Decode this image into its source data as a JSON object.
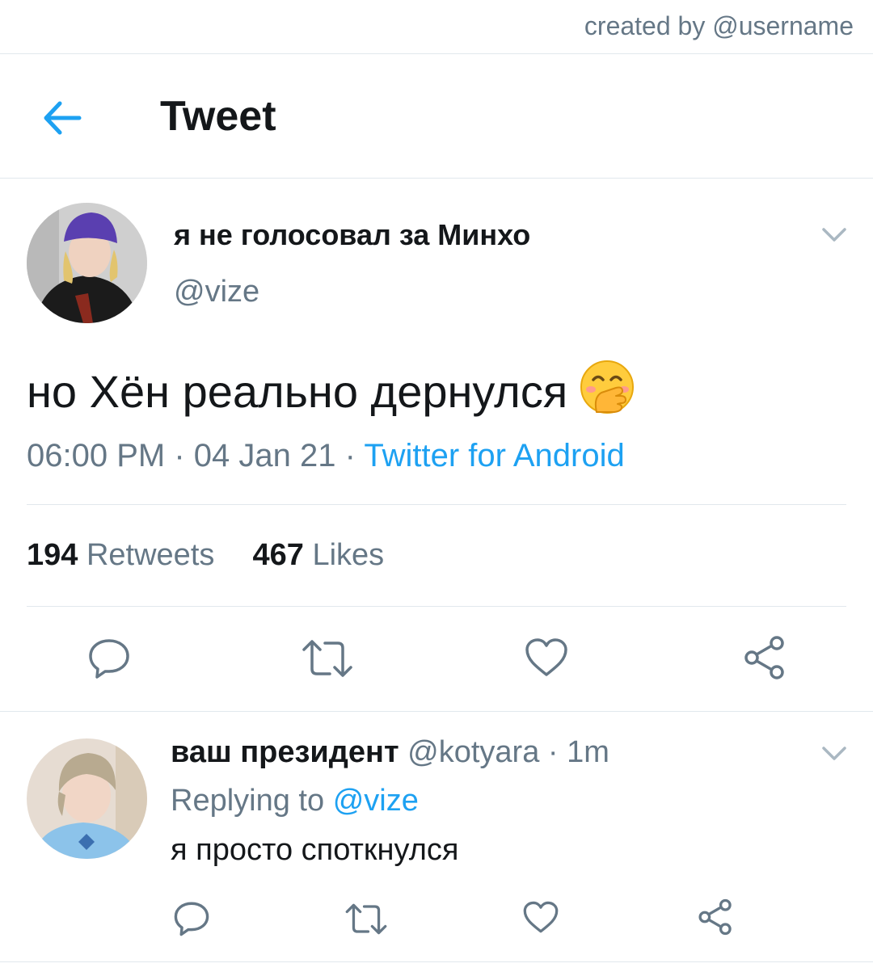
{
  "watermark": "created by @username",
  "header": {
    "title": "Tweet",
    "back_icon": "arrow-left-icon"
  },
  "main_tweet": {
    "display_name": "я не голосовал за Минхо",
    "handle": "@vize",
    "text": "но Хён реально дернулся",
    "emoji": "face-with-hand-over-mouth-emoji",
    "time": "06:00 PM",
    "date": "04 Jan 21",
    "source": "Twitter for Android",
    "sep": "·",
    "retweets_count": "194",
    "retweets_label": "Retweets",
    "likes_count": "467",
    "likes_label": "Likes"
  },
  "reply": {
    "display_name": "ваш президент",
    "handle": "@kotyara",
    "time": "1m",
    "sep": "·",
    "replying_label": "Replying to",
    "replying_to": "@vize",
    "text": "я просто споткнулся"
  },
  "colors": {
    "accent": "#1da1f2",
    "muted": "#657786",
    "text": "#14171a",
    "border": "#e1e8ed"
  }
}
